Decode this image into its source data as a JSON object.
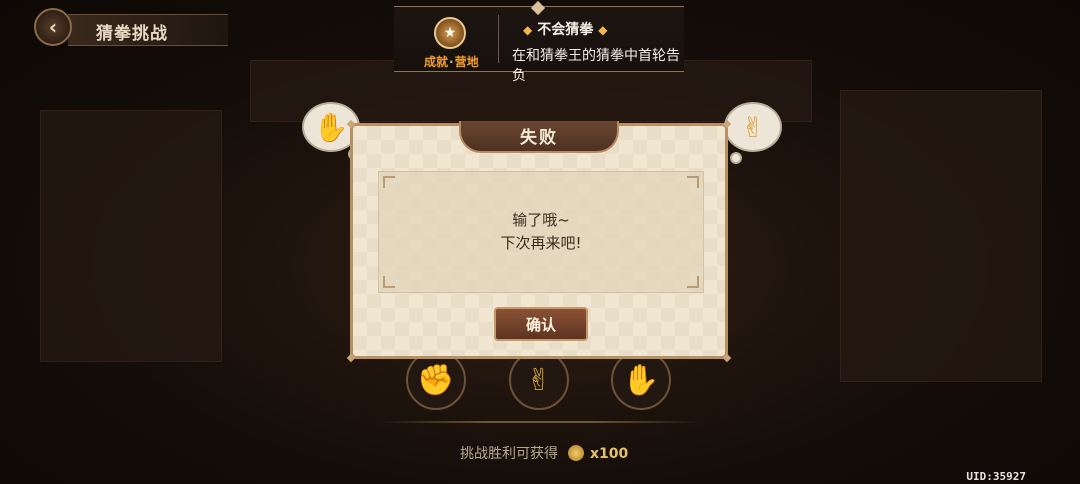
{
  "header": {
    "title": "猜拳挑战",
    "back_icon": "chevron-left-icon"
  },
  "achievement": {
    "tag_left": "成就",
    "tag_right": "营地",
    "name": "不会猜拳",
    "description": "在和猜拳王的猜拳中首轮告负",
    "badge_icon": "trophy-badge-icon"
  },
  "opponent_hands": {
    "left": "blue-paper-hand-icon",
    "right": "yellow-scissors-hand-icon"
  },
  "choices": [
    {
      "name": "rock",
      "icon": "red-fist-icon",
      "glyph": "✊"
    },
    {
      "name": "scissors",
      "icon": "yellow-scissors-icon",
      "glyph": "✌"
    },
    {
      "name": "paper",
      "icon": "blue-paper-icon",
      "glyph": "✋"
    }
  ],
  "reward": {
    "label": "挑战胜利可获得",
    "amount": "x100",
    "icon": "coin-icon"
  },
  "uid": "UID:35927",
  "dialog": {
    "title": "失败",
    "line1": "输了哦~",
    "line2": "下次再来吧!",
    "confirm_label": "确认"
  }
}
